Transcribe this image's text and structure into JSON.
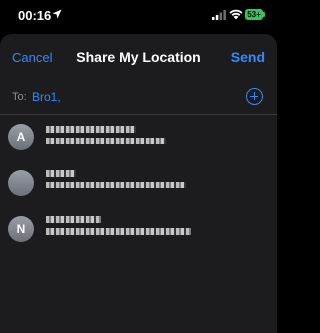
{
  "status_bar": {
    "time": "00:16",
    "battery": "53+",
    "icons": [
      "location-arrow-icon",
      "signal-icon",
      "wifi-icon",
      "battery-icon"
    ],
    "battery_color": "#35c759"
  },
  "nav": {
    "cancel_label": "Cancel",
    "title": "Share My Location",
    "send_label": "Send"
  },
  "to_field": {
    "label": "To:",
    "recipients": [
      "Bro1,"
    ],
    "add_icon": "plus-circle-icon"
  },
  "contacts": [
    {
      "avatar_initial": "A"
    },
    {
      "avatar_initial": ""
    },
    {
      "avatar_initial": "N"
    }
  ],
  "colors": {
    "accent": "#2f8bff",
    "sheet_background": "#1c1c1e",
    "page_background": "#000000"
  }
}
